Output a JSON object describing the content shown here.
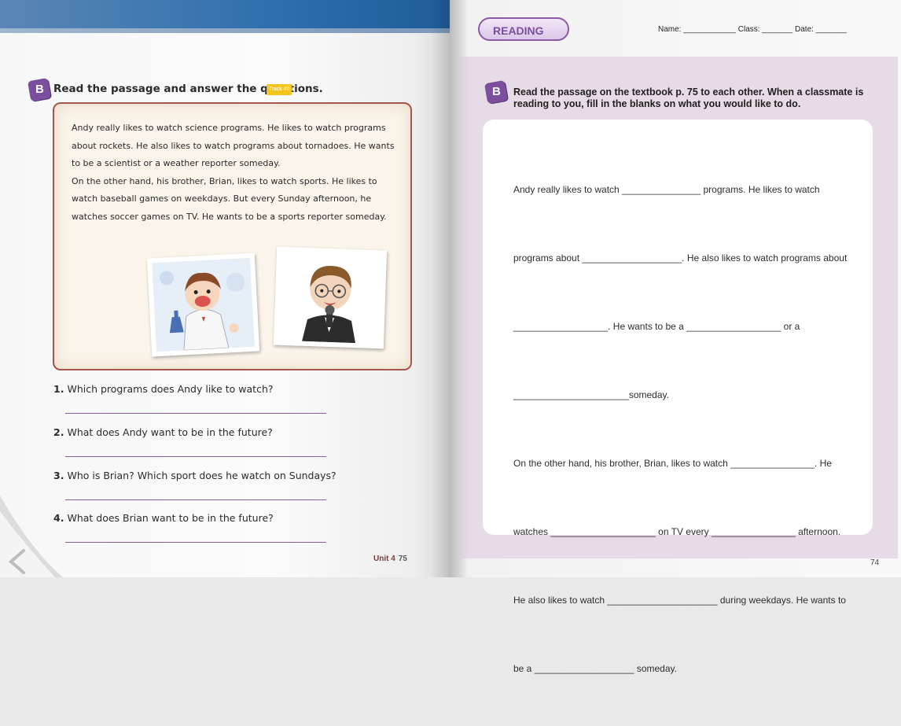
{
  "left_page": {
    "heading": "Read the passage and answer the questions.",
    "badge": "B",
    "track_label": "Track 40",
    "passage": [
      "Andy really likes to watch science programs. He likes to watch programs about rockets. He also likes to watch programs about tornadoes. He wants to be a scientist or a weather reporter someday.",
      "On the other hand, his brother, Brian, likes to watch sports. He likes to watch baseball games on weekdays. But every Sunday afternoon, he watches soccer games on TV. He wants to be a sports reporter someday."
    ],
    "questions": [
      {
        "num": "1.",
        "text": "Which programs does Andy like to watch?"
      },
      {
        "num": "2.",
        "text": "What does Andy want to be in the future?"
      },
      {
        "num": "3.",
        "text": "Who is Brian? Which sport does he watch on Sundays?"
      },
      {
        "num": "4.",
        "text": "What does Brian want to be in the future?"
      }
    ],
    "footer_unit": "Unit 4",
    "footer_page": "75"
  },
  "right_page": {
    "tag": "READING",
    "name_line": "Name: ____________ Class: _______ Date: _______",
    "badge": "B",
    "heading": "Read the passage on the textbook p. 75 to each other.  When a classmate is reading to you, fill in the blanks on what you would like to do.",
    "fill_lines": [
      "Andy really likes to watch _______________ programs. He likes to watch",
      "programs about ___________________. He also likes to watch programs about",
      "__________________. He wants to be a __________________ or a",
      "______________________someday.",
      "On the other hand, his brother, Brian, likes to watch ________________. He",
      "watches ____________________ on TV every ________________ afternoon.",
      "He also likes to watch _____________________ during weekdays. He wants to",
      "be a ___________________ someday."
    ],
    "footer_page": "74"
  },
  "colors": {
    "accent_purple": "#7b4f9e",
    "passage_border": "#a3574f",
    "panel_bg": "#e7dbe8",
    "top_band": "#2f6fae",
    "track_yellow": "#f3c51c"
  }
}
